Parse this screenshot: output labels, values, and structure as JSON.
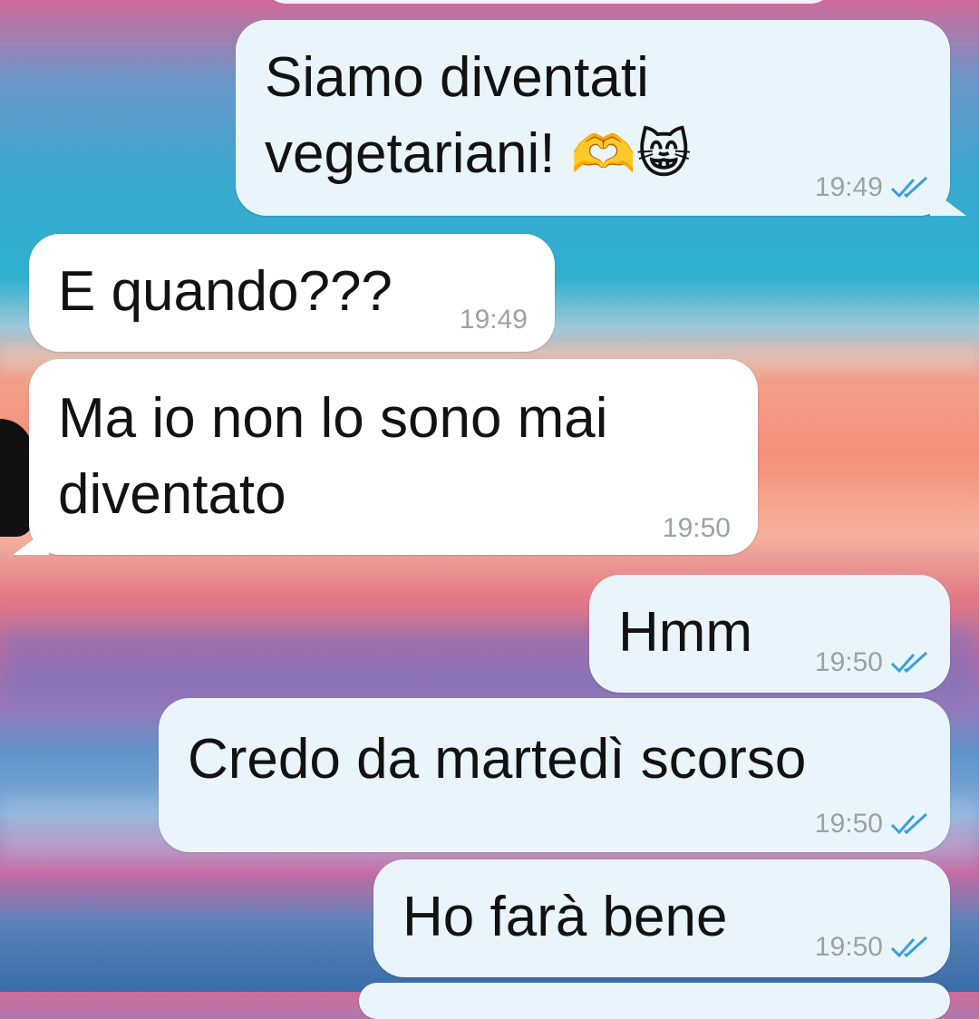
{
  "messages": [
    {
      "id": "m1",
      "direction": "out",
      "lines": [
        "Siamo diventati",
        "vegetariani!"
      ],
      "emojis": [
        "🫶",
        "😸"
      ],
      "time": "19:49",
      "status": "read"
    },
    {
      "id": "m2",
      "direction": "in",
      "lines": [
        "E quando???"
      ],
      "time": "19:49"
    },
    {
      "id": "m3",
      "direction": "in",
      "lines": [
        "Ma io non lo sono mai",
        "diventato"
      ],
      "time": "19:50"
    },
    {
      "id": "m4",
      "direction": "out",
      "lines": [
        "Hmm"
      ],
      "time": "19:50",
      "status": "read"
    },
    {
      "id": "m5",
      "direction": "out",
      "lines": [
        "Credo da martedì scorso"
      ],
      "time": "19:50",
      "status": "read"
    },
    {
      "id": "m6",
      "direction": "out",
      "lines": [
        "Ho farà bene"
      ],
      "time": "19:50",
      "status": "read"
    }
  ],
  "colors": {
    "outgoing": "#e9f4fb",
    "incoming": "#ffffff",
    "read_ticks": "#3aa0d8",
    "timestamp": "#9aa2a8"
  }
}
